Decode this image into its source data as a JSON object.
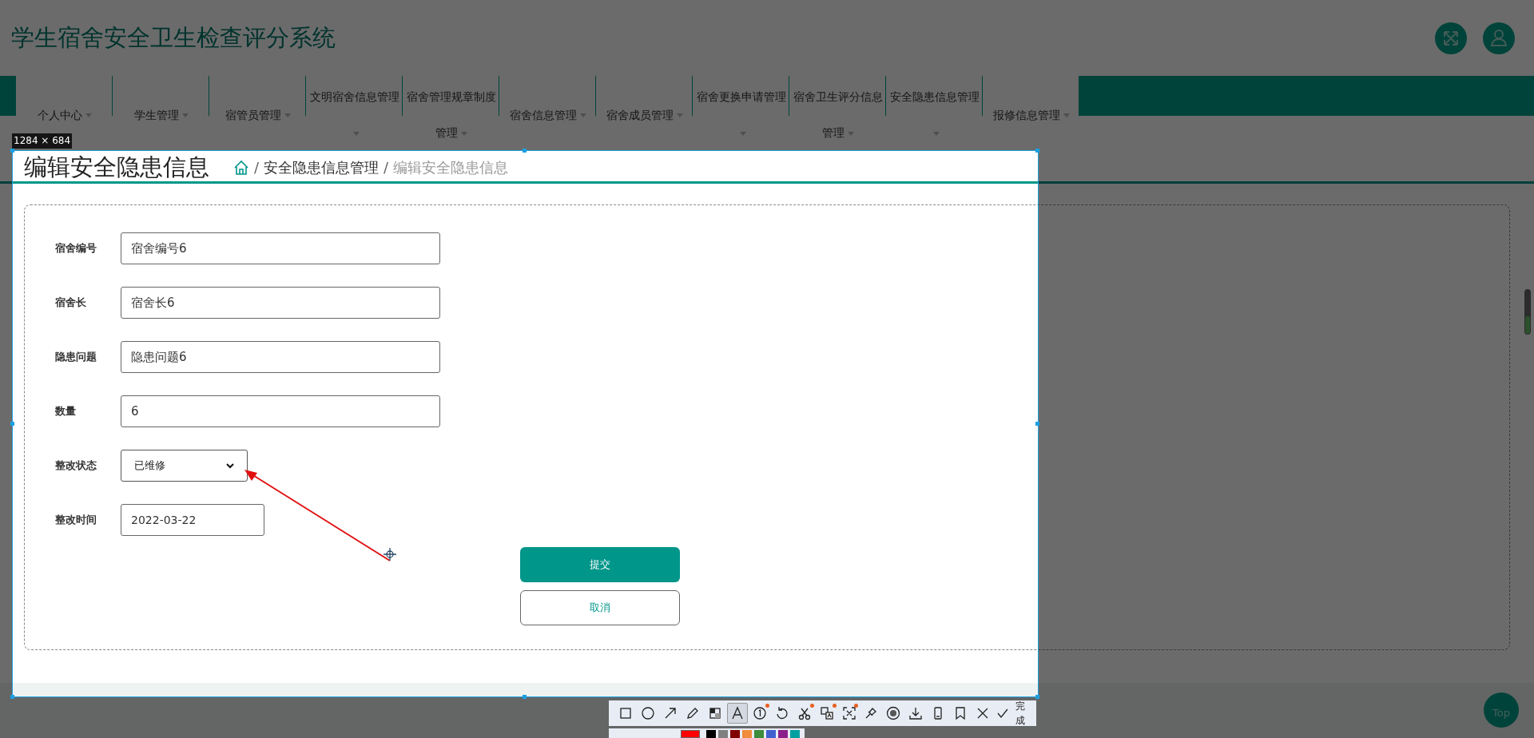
{
  "header": {
    "title": "学生宿舍安全卫生检查评分系统",
    "actions": [
      {
        "kind": "fullscreen"
      },
      {
        "kind": "user"
      }
    ]
  },
  "nav": {
    "items": [
      {
        "label": "个人中心"
      },
      {
        "label": "学生管理"
      },
      {
        "label": "宿管员管理"
      },
      {
        "label": "文明宿舍信息管理"
      },
      {
        "label": "宿舍管理规章制度管理"
      },
      {
        "label": "宿舍信息管理"
      },
      {
        "label": "宿舍成员管理"
      },
      {
        "label": "宿舍更换申请管理"
      },
      {
        "label": "宿舍卫生评分信息管理"
      },
      {
        "label": "安全隐患信息管理"
      },
      {
        "label": "报修信息管理"
      }
    ]
  },
  "page": {
    "title": "编辑安全隐患信息",
    "breadcrumb": [
      {
        "separator": "/",
        "label": "安全隐患信息管理"
      },
      {
        "separator": "/",
        "label": "编辑安全隐患信息"
      }
    ]
  },
  "form": {
    "fields": [
      {
        "label": "宿舍编号",
        "value": "宿舍编号6",
        "kind": "text"
      },
      {
        "label": "宿舍长",
        "value": "宿舍长6",
        "kind": "text"
      },
      {
        "label": "隐患问题",
        "value": "隐患问题6",
        "kind": "text"
      },
      {
        "label": "数量",
        "value": "6",
        "kind": "text"
      },
      {
        "label": "整改状态",
        "value": "已维修",
        "kind": "select"
      },
      {
        "label": "整改时间",
        "value": "2022-03-22",
        "kind": "date"
      }
    ],
    "buttons": [
      {
        "label": "提交",
        "kind": "primary"
      },
      {
        "label": "取消",
        "kind": "secondary"
      }
    ]
  },
  "back_to_top": "Top",
  "capture": {
    "size_label": "1284 × 684",
    "tools": [
      {
        "kind": "rectangle",
        "selected": false,
        "badge": false
      },
      {
        "kind": "circle",
        "selected": false,
        "badge": false
      },
      {
        "kind": "arrow",
        "selected": false,
        "badge": false
      },
      {
        "kind": "pencil",
        "selected": false,
        "badge": false
      },
      {
        "kind": "mosaic",
        "selected": false,
        "badge": false
      },
      {
        "kind": "text",
        "selected": true,
        "badge": false
      },
      {
        "kind": "number",
        "selected": false,
        "badge": true
      },
      {
        "kind": "undo",
        "selected": false,
        "badge": false
      },
      {
        "kind": "scissors",
        "selected": false,
        "badge": true
      },
      {
        "kind": "translate",
        "selected": false,
        "badge": true
      },
      {
        "kind": "ocr",
        "selected": false,
        "badge": true
      },
      {
        "kind": "pin",
        "selected": false,
        "badge": false
      },
      {
        "kind": "record",
        "selected": false,
        "badge": false
      },
      {
        "kind": "download",
        "selected": false,
        "badge": false
      },
      {
        "kind": "phone",
        "selected": false,
        "badge": false
      },
      {
        "kind": "bookmark",
        "selected": false,
        "badge": false
      },
      {
        "kind": "close",
        "selected": false,
        "badge": false
      }
    ],
    "finish_label": "完成",
    "palette": [
      {
        "color": "#ff0000",
        "selected": true
      },
      {
        "color": "#000000",
        "selected": false
      },
      {
        "color": "#808080",
        "selected": false
      },
      {
        "color": "#800000",
        "selected": false
      },
      {
        "color": "#f08c3c",
        "selected": false
      },
      {
        "color": "#3c8c3c",
        "selected": false
      },
      {
        "color": "#4060d0",
        "selected": false
      },
      {
        "color": "#8c1e8c",
        "selected": false
      },
      {
        "color": "#00a0a0",
        "selected": false
      }
    ]
  }
}
